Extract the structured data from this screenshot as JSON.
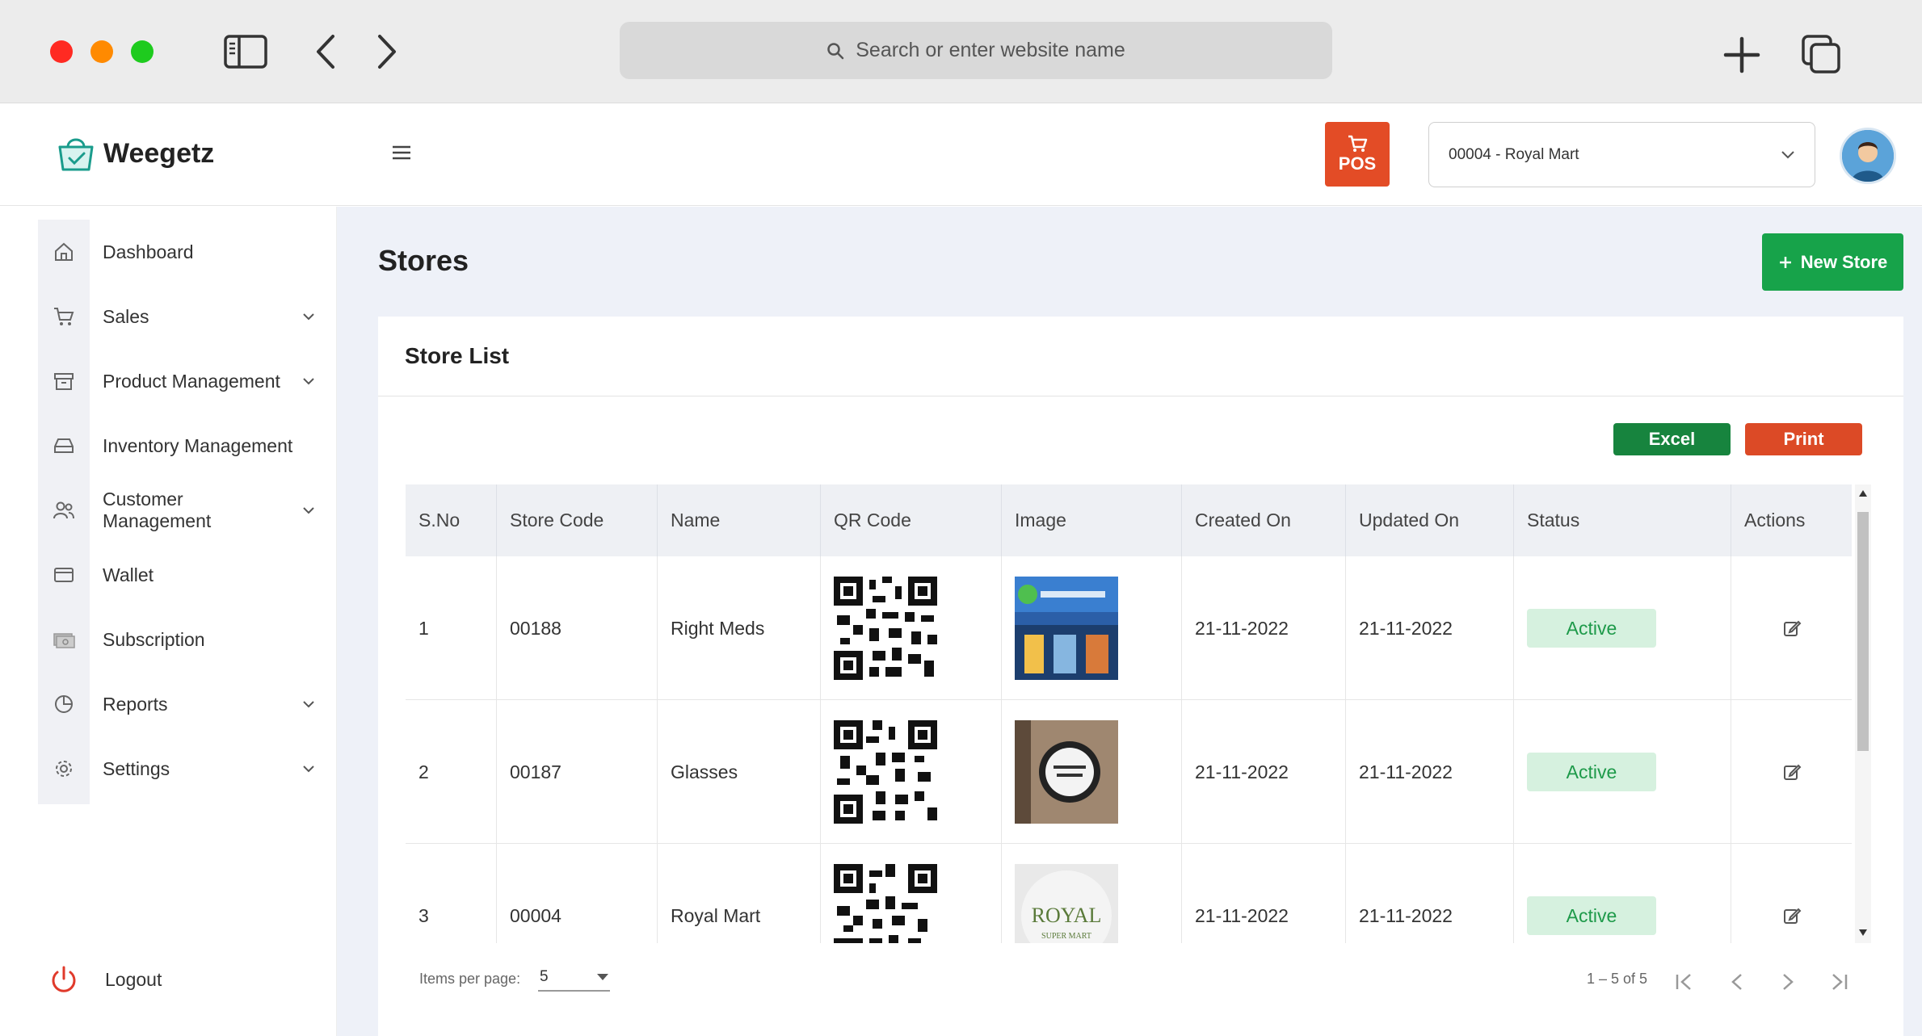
{
  "browser": {
    "url_placeholder": "Search or enter website name"
  },
  "header": {
    "brand": "Weegetz",
    "pos_label": "POS",
    "store_selector": "00004 - Royal Mart"
  },
  "sidebar": {
    "items": [
      {
        "label": "Dashboard",
        "icon": "home-icon",
        "expandable": false
      },
      {
        "label": "Sales",
        "icon": "cart-icon",
        "expandable": true
      },
      {
        "label": "Product Management",
        "icon": "archive-icon",
        "expandable": true
      },
      {
        "label": "Inventory Management",
        "icon": "inbox-icon",
        "expandable": false
      },
      {
        "label": "Customer Management",
        "icon": "users-icon",
        "expandable": true
      },
      {
        "label": "Wallet",
        "icon": "wallet-icon",
        "expandable": false
      },
      {
        "label": "Subscription",
        "icon": "money-icon",
        "expandable": false
      },
      {
        "label": "Reports",
        "icon": "pie-chart-icon",
        "expandable": true
      },
      {
        "label": "Settings",
        "icon": "gear-icon",
        "expandable": true
      }
    ],
    "logout": "Logout"
  },
  "page": {
    "title": "Stores",
    "new_store_label": "New Store"
  },
  "card": {
    "title": "Store List",
    "excel_label": "Excel",
    "print_label": "Print"
  },
  "table": {
    "columns": [
      "S.No",
      "Store Code",
      "Name",
      "QR Code",
      "Image",
      "Created On",
      "Updated On",
      "Status",
      "Actions"
    ],
    "rows": [
      {
        "sno": "1",
        "code": "00188",
        "name": "Right Meds",
        "created": "21-11-2022",
        "updated": "21-11-2022",
        "status": "Active"
      },
      {
        "sno": "2",
        "code": "00187",
        "name": "Glasses",
        "created": "21-11-2022",
        "updated": "21-11-2022",
        "status": "Active"
      },
      {
        "sno": "3",
        "code": "00004",
        "name": "Royal Mart",
        "created": "21-11-2022",
        "updated": "21-11-2022",
        "status": "Active"
      }
    ]
  },
  "pagination": {
    "items_per_page_label": "Items per page:",
    "items_per_page_value": "5",
    "range": "1 – 5 of 5"
  },
  "colors": {
    "primary_green": "#17a34a",
    "excel_green": "#17843e",
    "orange_red": "#e34c26",
    "status_bg": "#d6f1df",
    "status_text": "#1e9a4a"
  }
}
